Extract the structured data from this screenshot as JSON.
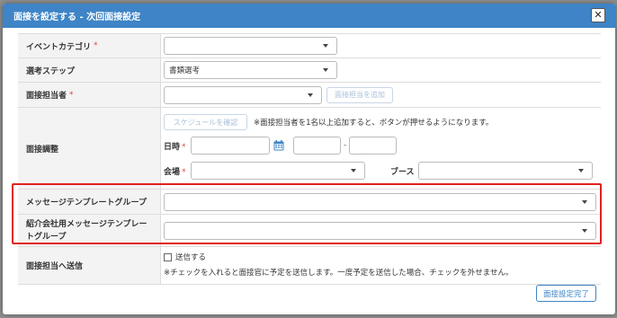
{
  "modal": {
    "title": "面接を設定する - 次回面接設定",
    "close_symbol": "✕",
    "submit_label": "面接設定完了"
  },
  "form": {
    "event_category": {
      "label": "イベントカテゴリ",
      "required": "*",
      "value": ""
    },
    "selection_step": {
      "label": "選考ステップ",
      "value": "書類選考"
    },
    "interviewer": {
      "label": "面接担当者",
      "required": "*",
      "value": "",
      "add_button": "面接担当を追加"
    },
    "schedule": {
      "label": "面接調整",
      "check_button": "スケジュールを確認",
      "note": "※面接担当者を1名以上追加すると、ボタンが押せるようになります。",
      "datetime_label": "日時",
      "datetime_required": "*",
      "time_separator": "-",
      "venue_label": "会場",
      "venue_required": "*",
      "booth_label": "ブース"
    },
    "message_template_group": {
      "label": "メッセージテンプレートグループ",
      "value": ""
    },
    "agency_message_template_group": {
      "label": "紹介会社用メッセージテンプレートグループ",
      "value": ""
    },
    "send_to_interviewer": {
      "label": "面接担当へ送信",
      "checkbox_label": "送信する",
      "checked": false,
      "note": "※チェックを入れると面接官に予定を送信します。一度予定を送信した場合、チェックを外せません。"
    }
  },
  "colors": {
    "header": "#3e84c6",
    "required": "#e0443f",
    "highlight": "#e02020",
    "calendar_icon": "#3e84c6"
  },
  "icons": [
    "close-icon",
    "chevron-down-icon",
    "calendar-icon"
  ]
}
